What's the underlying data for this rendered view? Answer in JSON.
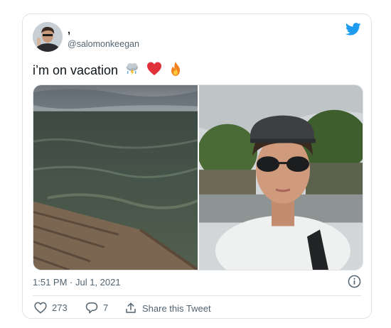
{
  "tweet": {
    "display_name": ",",
    "handle": "@salomonkeegan",
    "text": "i’m on vacation",
    "emojis": [
      "cloud-with-lightning-and-rain-emoji",
      "red-heart-emoji",
      "fire-emoji"
    ],
    "timestamp": "1:51 PM · Jul 1, 2021",
    "likes": "273",
    "replies": "7",
    "share_label": "Share this Tweet"
  },
  "media": {
    "photos": [
      "sea-and-wooden-dock-photo",
      "selfie-with-sunglasses-photo"
    ]
  },
  "colors": {
    "twitter_blue": "#1d9bf0",
    "text": "#0f1419",
    "secondary_text": "#536471",
    "border": "#dfe3e7",
    "heart_red": "#e0303a"
  }
}
